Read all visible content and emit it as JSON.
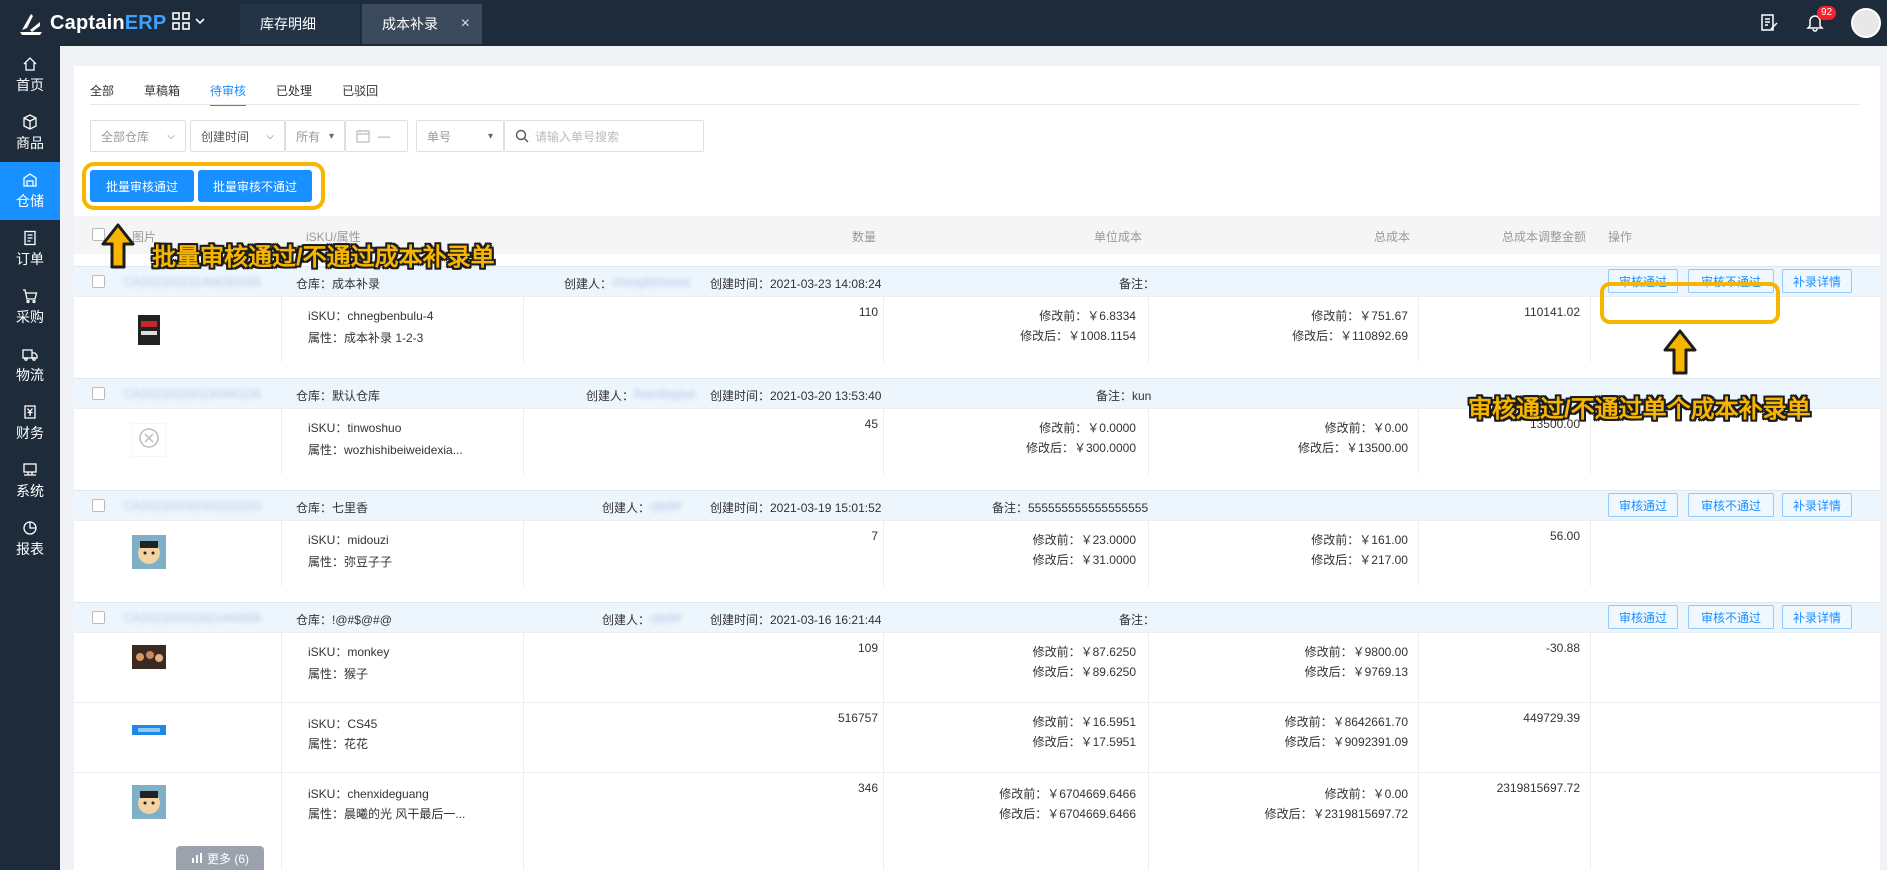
{
  "app": {
    "brand_main": "Captain",
    "brand_accent": "ERP"
  },
  "top_tabs": [
    {
      "label": "库存明细"
    },
    {
      "label": "成本补录",
      "close": "×"
    }
  ],
  "notifications": {
    "count": "92"
  },
  "sidebar": {
    "items": [
      {
        "label": "首页",
        "icon": "home-icon"
      },
      {
        "label": "商品",
        "icon": "cube-icon"
      },
      {
        "label": "仓储",
        "icon": "warehouse-icon",
        "active": true
      },
      {
        "label": "订单",
        "icon": "order-icon"
      },
      {
        "label": "采购",
        "icon": "cart-icon"
      },
      {
        "label": "物流",
        "icon": "truck-icon"
      },
      {
        "label": "财务",
        "icon": "finance-icon"
      },
      {
        "label": "系统",
        "icon": "system-icon"
      },
      {
        "label": "报表",
        "icon": "report-icon"
      }
    ]
  },
  "status_tabs": [
    {
      "label": "全部"
    },
    {
      "label": "草稿箱"
    },
    {
      "label": "待审核",
      "active": true
    },
    {
      "label": "已处理"
    },
    {
      "label": "已驳回"
    }
  ],
  "filters": {
    "warehouse": "全部仓库",
    "time_type": "创建时间",
    "time_range": "所有",
    "date": "—",
    "number_type": "单号",
    "search_placeholder": "请输入单号搜索"
  },
  "batch": {
    "approve": "批量审核通过",
    "reject": "批量审核不通过"
  },
  "table_header": {
    "image": "图片",
    "sku": "iSKU/属性",
    "qty": "数量",
    "unit_cost": "单位成本",
    "total_cost": "总成本",
    "adjust": "总成本调整金额",
    "ops": "操作"
  },
  "actions": {
    "approve": "审核通过",
    "reject": "审核不通过",
    "detail": "补录详情"
  },
  "groups": [
    {
      "order_no": "CA202103231406282035",
      "warehouse": "仓库：成本补录",
      "creator_label": "创建人：",
      "creator": "chenglizhixiola",
      "time": "创建时间：2021-03-23 14:08:24",
      "remark": "备注：",
      "rows": [
        {
          "isku": "iSKU：chnegbenbulu-4",
          "attr": "属性：成本补录 1-2-3",
          "qty": "110",
          "unit_before": "修改前：￥6.8334",
          "unit_after": "修改后：￥1008.1154",
          "total_before": "修改前：￥751.67",
          "total_after": "修改后：￥110892.69",
          "adjust": "110141.02"
        }
      ]
    },
    {
      "order_no": "CA202103200135340135",
      "warehouse": "仓库：默认仓库",
      "creator_label": "创建人：",
      "creator": "fluentlsglud",
      "time": "创建时间：2021-03-20 13:53:40",
      "remark": "备注：kun",
      "rows": [
        {
          "isku": "iSKU：tinwoshuo",
          "attr": "属性：wozhishibeiweidexia...",
          "qty": "45",
          "unit_before": "修改前：￥0.0000",
          "unit_after": "修改后：￥300.0000",
          "total_before": "修改前：￥0.00",
          "total_after": "修改后：￥13500.00",
          "adjust": "13500.00"
        }
      ]
    },
    {
      "order_no": "CA202103191501521520",
      "warehouse": "仓库：七里香",
      "creator_label": "创建人：",
      "creator": "cjbdlif",
      "time": "创建时间：2021-03-19 15:01:52",
      "remark": "备注：555555555555555555",
      "rows": [
        {
          "isku": "iSKU：midouzi",
          "attr": "属性：弥豆子子",
          "qty": "7",
          "unit_before": "修改前：￥23.0000",
          "unit_after": "修改后：￥31.0000",
          "total_before": "修改前：￥161.00",
          "total_after": "修改后：￥217.00",
          "adjust": "56.00"
        }
      ]
    },
    {
      "order_no": "CA202103161621440008",
      "warehouse": "仓库：!@#$@#@",
      "creator_label": "创建人：",
      "creator": "cjbdlif",
      "time": "创建时间：2021-03-16 16:21:44",
      "remark": "备注：",
      "rows": [
        {
          "isku": "iSKU：monkey",
          "attr": "属性：猴子",
          "qty": "109",
          "unit_before": "修改前：￥87.6250",
          "unit_after": "修改后：￥89.6250",
          "total_before": "修改前：￥9800.00",
          "total_after": "修改后：￥9769.13",
          "adjust": "-30.88"
        },
        {
          "isku": "iSKU：CS45",
          "attr": "属性：花花",
          "qty": "516757",
          "unit_before": "修改前：￥16.5951",
          "unit_after": "修改后：￥17.5951",
          "total_before": "修改前：￥8642661.70",
          "total_after": "修改后：￥9092391.09",
          "adjust": "449729.39"
        },
        {
          "isku": "iSKU：chenxideguang",
          "attr": "属性：晨曦的光 风干最后一...",
          "qty": "346",
          "unit_before": "修改前：￥6704669.6466",
          "unit_after": "修改后：￥6704669.6466",
          "total_before": "修改前：￥0.00",
          "total_after": "修改后：￥2319815697.72",
          "adjust": "2319815697.72"
        }
      ]
    }
  ],
  "more": {
    "label": "更多 (6)"
  },
  "annotations": {
    "batch": "批量审核通过/不通过成本补录单",
    "single": "审核通过/不通过单个成本补录单"
  },
  "colors": {
    "primary": "#1890ff",
    "dark": "#1d2b3a",
    "highlight": "#f7b500"
  }
}
